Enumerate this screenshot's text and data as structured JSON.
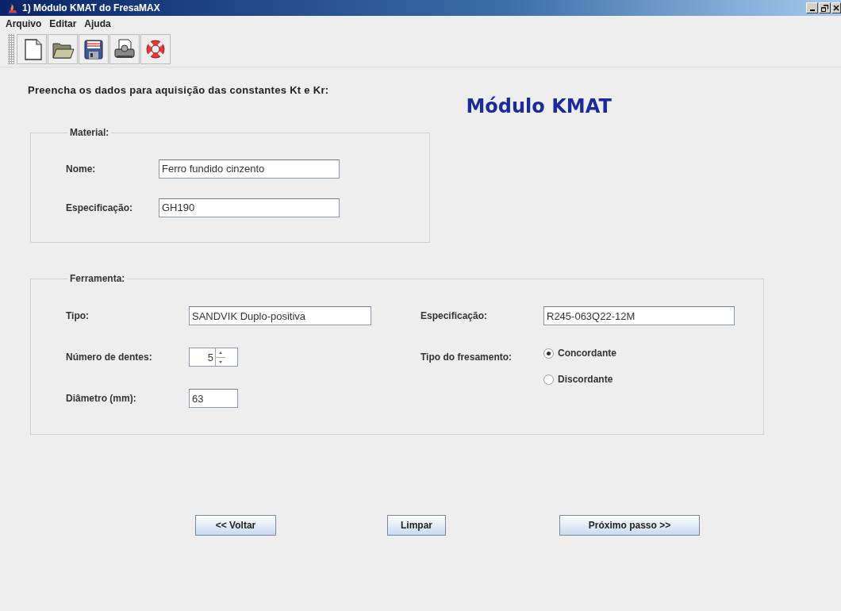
{
  "window": {
    "title": "1) Módulo KMAT do FresaMAX"
  },
  "menu": [
    "Arquivo",
    "Editar",
    "Ajuda"
  ],
  "toolbar": [
    {
      "kind": "new"
    },
    {
      "kind": "open"
    },
    {
      "kind": "save"
    },
    {
      "kind": "print"
    },
    {
      "kind": "help"
    }
  ],
  "instruction": "Preencha os dados para aquisição das constantes Kt e Kr:",
  "heading": "Módulo KMAT",
  "material": {
    "legend": "Material:",
    "fields": [
      {
        "label": "Nome:",
        "value": "Ferro fundido cinzento"
      },
      {
        "label": "Especificação:",
        "value": "GH190"
      }
    ]
  },
  "ferramenta": {
    "legend": "Ferramenta:",
    "tipo": {
      "label": "Tipo:",
      "value": "SANDVIK Duplo-positiva"
    },
    "dentes": {
      "label": "Número de dentes:",
      "value": "5"
    },
    "diametro": {
      "label": "Diâmetro (mm):",
      "value": "63"
    },
    "especificacao": {
      "label": "Especificação:",
      "value": "R245-063Q22-12M"
    },
    "fresamento": {
      "label": "Tipo do fresamento:",
      "options": [
        {
          "label": "Concordante",
          "selected": true
        },
        {
          "label": "Discordante",
          "selected": false
        }
      ]
    }
  },
  "buttons": [
    "<< Voltar",
    "Limpar",
    "Próximo passo >>"
  ]
}
